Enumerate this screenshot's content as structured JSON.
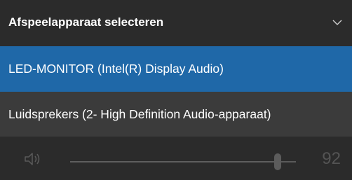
{
  "header": {
    "title": "Afspeelapparaat selecteren",
    "chevron_icon": "chevron-down-icon"
  },
  "devices": [
    {
      "label": "LED-MONITOR (Intel(R) Display Audio)",
      "selected": true
    },
    {
      "label": "Luidsprekers (2- High Definition Audio-apparaat)",
      "selected": false
    }
  ],
  "volume": {
    "icon": "speaker-icon",
    "value": "92",
    "level_fraction": 0.92
  },
  "colors": {
    "background": "#2b2b2b",
    "selected_item": "#1f68a8",
    "hover_item": "#3b3b3b",
    "disabled_text": "#545454"
  }
}
